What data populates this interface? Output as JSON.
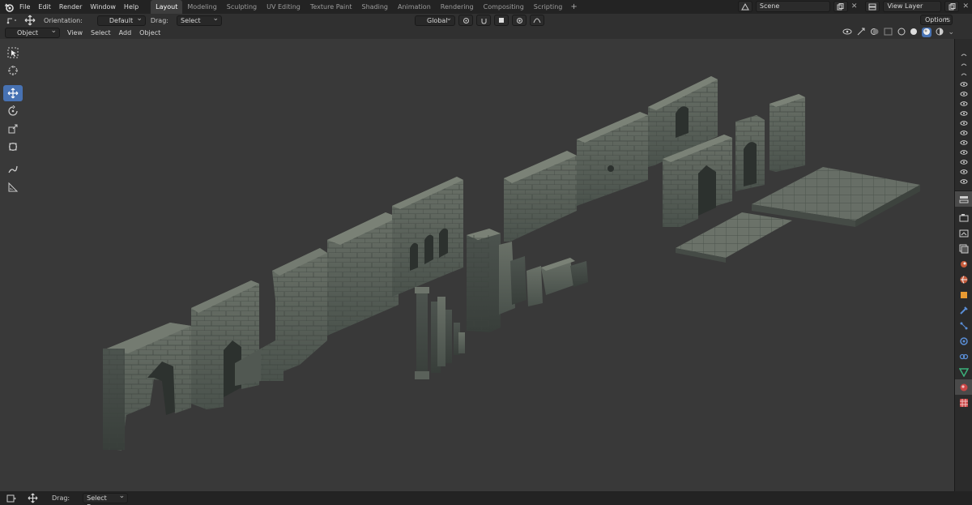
{
  "menu": [
    "File",
    "Edit",
    "Render",
    "Window",
    "Help"
  ],
  "workspaces": [
    "Layout",
    "Modeling",
    "Sculpting",
    "UV Editing",
    "Texture Paint",
    "Shading",
    "Animation",
    "Rendering",
    "Compositing",
    "Scripting"
  ],
  "active_workspace": "Layout",
  "scene_name": "Scene",
  "view_layer": "View Layer",
  "tool_header": {
    "orientation_label": "Orientation:",
    "orientation_value": "Default",
    "drag_label": "Drag:",
    "drag_value": "Select Box",
    "transform_orientation": "Global",
    "options_label": "Options"
  },
  "viewport_header": {
    "mode": "Object Mode",
    "menus": [
      "View",
      "Select",
      "Add",
      "Object"
    ]
  },
  "left_tools": [
    "select-box-icon",
    "cursor-icon",
    "move-icon",
    "rotate-icon",
    "scale-icon",
    "transform-icon",
    "annotate-icon",
    "measure-icon"
  ],
  "status_bar": {
    "drag_label": "Drag:",
    "drag_value": "Select Box"
  },
  "colors": {
    "accent": "#4772b3",
    "viewport_bg": "#393939",
    "stone": "#5d645c"
  }
}
